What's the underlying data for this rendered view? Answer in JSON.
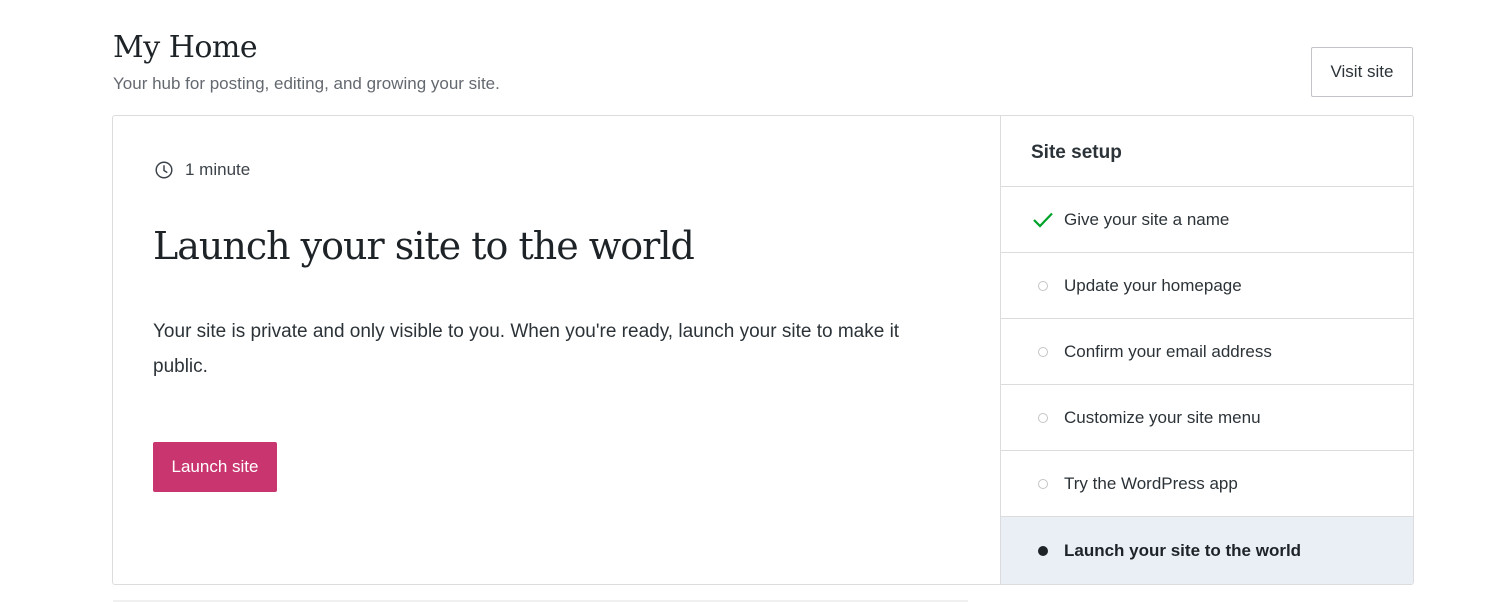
{
  "header": {
    "title": "My Home",
    "subtitle": "Your hub for posting, editing, and growing your site.",
    "visit_label": "Visit site"
  },
  "task": {
    "timing_icon": "clock-icon",
    "timing": "1 minute",
    "title": "Launch your site to the world",
    "description": "Your site is private and only visible to you. When you're ready, launch your site to make it public.",
    "button_label": "Launch site",
    "button_color": "#c9356e"
  },
  "checklist": {
    "title": "Site setup",
    "items": [
      {
        "label": "Give your site a name",
        "state": "done"
      },
      {
        "label": "Update your homepage",
        "state": "todo"
      },
      {
        "label": "Confirm your email address",
        "state": "todo"
      },
      {
        "label": "Customize your site menu",
        "state": "todo"
      },
      {
        "label": "Try the WordPress app",
        "state": "todo"
      },
      {
        "label": "Launch your site to the world",
        "state": "active"
      }
    ],
    "done_color": "#00a32a",
    "active_bg": "#e9eff5"
  }
}
